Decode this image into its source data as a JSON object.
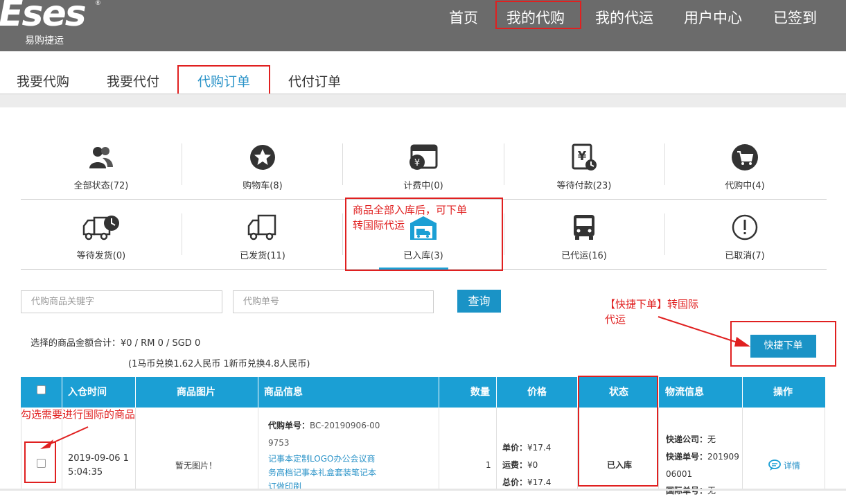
{
  "header": {
    "logo_text": "Eses",
    "logo_reg": "®",
    "logo_sub": "易购捷运",
    "nav": [
      "首页",
      "我的代购",
      "我的代运",
      "用户中心",
      "已签到"
    ]
  },
  "subtabs": [
    "我要代购",
    "我要代付",
    "代购订单",
    "代付订单"
  ],
  "status": [
    {
      "label": "全部状态(72)",
      "icon": "users-icon"
    },
    {
      "label": "购物车(8)",
      "icon": "star-icon"
    },
    {
      "label": "计费中(0)",
      "icon": "yen-card-icon"
    },
    {
      "label": "等待付款(23)",
      "icon": "yen-clock-icon"
    },
    {
      "label": "代购中(4)",
      "icon": "cart-icon"
    },
    {
      "label": "等待发货(0)",
      "icon": "truck-clock-icon"
    },
    {
      "label": "已发货(11)",
      "icon": "truck-icon"
    },
    {
      "label": "已入库(3)",
      "icon": "warehouse-icon"
    },
    {
      "label": "已代运(16)",
      "icon": "bus-icon"
    },
    {
      "label": "已取消(7)",
      "icon": "exclamation-icon"
    }
  ],
  "annotations": {
    "warehouse_note_line1": "商品全部入库后，可下单",
    "warehouse_note_line2": "转国际代运",
    "quick_order_note_line1": "【快捷下单】转国际",
    "quick_order_note_line2": "代运",
    "checkbox_note": "勾选需要进行国际的商品"
  },
  "search": {
    "keyword_placeholder": "代购商品关键字",
    "order_placeholder": "代购单号",
    "query_label": "查询"
  },
  "summary": {
    "total_text": "选择的商品金额合计：¥0  / RM 0  / SGD 0",
    "rate_text": "(1马币兑换1.62人民币 1新币兑换4.8人民币)"
  },
  "quick_order_label": "快捷下单",
  "table": {
    "headers": [
      "入仓时间",
      "商品图片",
      "商品信息",
      "数量",
      "价格",
      "状态",
      "物流信息",
      "操作"
    ],
    "row": {
      "time_line1": "2019-09-06 1",
      "time_line2": "5:04:35",
      "image": "暂无图片！",
      "order_no_label": "代购单号：",
      "order_no_line1": "BC-20190906-00",
      "order_no_line2": "9753",
      "desc_line1": "记事本定制LOGO办公会议商",
      "desc_line2": "务高档记事本礼盒套装笔记本",
      "desc_line3": "订做印刷",
      "qty": "1",
      "unit_label": "单价：",
      "unit_value": "¥17.4",
      "freight_label": "运费：",
      "freight_value": "¥0",
      "total_label": "总价：",
      "total_value": "¥17.4",
      "status": "已入库",
      "courier_label": "快递公司：",
      "courier_value": "无",
      "tracking_label": "快递单号：",
      "tracking_line1": "201909",
      "tracking_line2": "06001",
      "intl_label": "国际单号：",
      "intl_value": "无",
      "detail_label": "详情"
    }
  },
  "colors": {
    "accent": "#1b9fd4",
    "header_bg": "#6b6b6b",
    "annotation": "#e02020"
  }
}
